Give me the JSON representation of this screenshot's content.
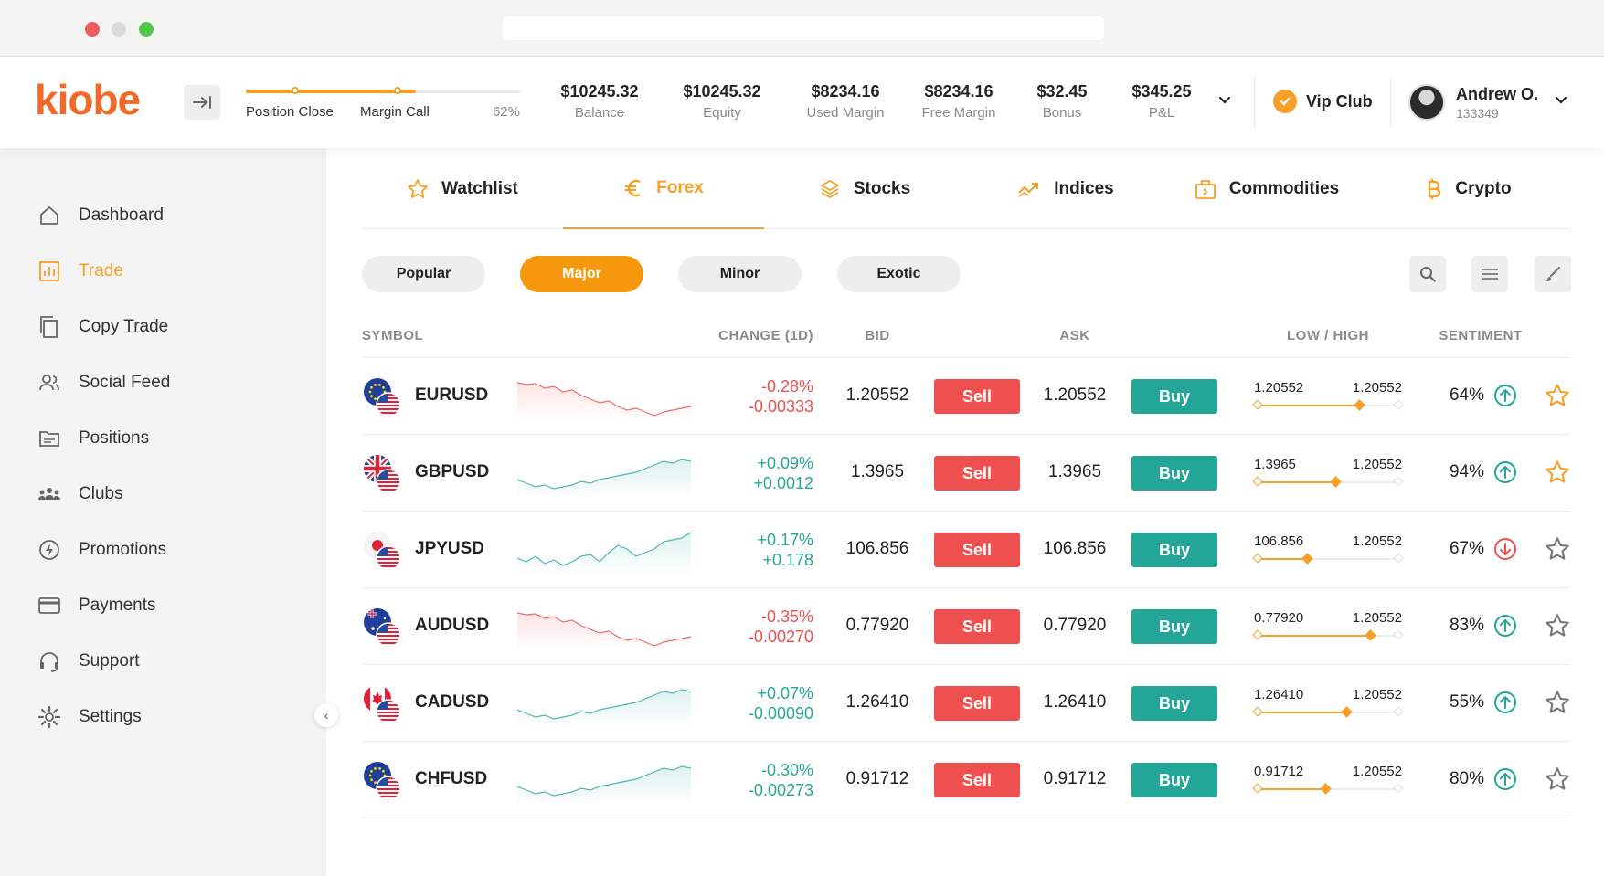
{
  "brand": {
    "logo": "kiobe",
    "accent": "#f6a02a",
    "sell_color": "#ef4f4f",
    "buy_color": "#23a698"
  },
  "margin_meter": {
    "label_left": "Position Close",
    "label_mid": "Margin Call",
    "percent_label": "62%",
    "fill_percent": 62
  },
  "stats": [
    {
      "value": "$10245.32",
      "label": "Balance"
    },
    {
      "value": "$10245.32",
      "label": "Equity"
    },
    {
      "value": "$8234.16",
      "label": "Used Margin"
    },
    {
      "value": "$8234.16",
      "label": "Free Margin"
    },
    {
      "value": "$32.45",
      "label": "Bonus"
    },
    {
      "value": "$345.25",
      "label": "P&L"
    }
  ],
  "vip": {
    "label": "Vip Club"
  },
  "user": {
    "name": "Andrew O.",
    "id": "133349"
  },
  "sidebar": {
    "items": [
      {
        "label": "Dashboard",
        "icon": "home-icon",
        "active": false
      },
      {
        "label": "Trade",
        "icon": "chart-icon",
        "active": true
      },
      {
        "label": "Copy Trade",
        "icon": "copy-icon",
        "active": false
      },
      {
        "label": "Social Feed",
        "icon": "users-icon",
        "active": false
      },
      {
        "label": "Positions",
        "icon": "folder-icon",
        "active": false
      },
      {
        "label": "Clubs",
        "icon": "group-icon",
        "active": false
      },
      {
        "label": "Promotions",
        "icon": "lightning-icon",
        "active": false
      },
      {
        "label": "Payments",
        "icon": "card-icon",
        "active": false
      },
      {
        "label": "Support",
        "icon": "headset-icon",
        "active": false
      },
      {
        "label": "Settings",
        "icon": "gear-icon",
        "active": false
      }
    ]
  },
  "tabs": [
    {
      "label": "Watchlist",
      "icon": "star-icon",
      "active": false
    },
    {
      "label": "Forex",
      "icon": "euro-icon",
      "active": true
    },
    {
      "label": "Stocks",
      "icon": "layers-icon",
      "active": false
    },
    {
      "label": "Indices",
      "icon": "trend-icon",
      "active": false
    },
    {
      "label": "Commodities",
      "icon": "briefcase-icon",
      "active": false
    },
    {
      "label": "Crypto",
      "icon": "bitcoin-icon",
      "active": false
    }
  ],
  "filters": [
    {
      "label": "Popular",
      "active": false
    },
    {
      "label": "Major",
      "active": true
    },
    {
      "label": "Minor",
      "active": false
    },
    {
      "label": "Exotic",
      "active": false
    }
  ],
  "columns": {
    "symbol": "SYMBOL",
    "change": "CHANGE (1D)",
    "bid": "BID",
    "ask": "ASK",
    "lowhigh": "LOW / HIGH",
    "sentiment": "SENTIMENT"
  },
  "buttons": {
    "sell": "Sell",
    "buy": "Buy"
  },
  "rows": [
    {
      "symbol": "EURUSD",
      "flag": "eu",
      "trend": "down",
      "change_pct": "-0.28%",
      "change_abs": "-0.00333",
      "dir": "neg",
      "bid": "1.20552",
      "ask": "1.20552",
      "low": "1.20552",
      "high": "1.20552",
      "range_pos": 0.72,
      "sentiment": "64%",
      "sent_dir": "up",
      "fav": true,
      "spark": [
        8,
        10,
        9,
        14,
        12,
        18,
        16,
        22,
        26,
        30,
        28,
        34,
        38,
        36,
        40,
        44,
        40,
        38,
        36,
        34
      ]
    },
    {
      "symbol": "GBPUSD",
      "flag": "gb",
      "trend": "up",
      "change_pct": "+0.09%",
      "change_abs": "+0.0012",
      "dir": "pos",
      "bid": "1.3965",
      "ask": "1.3965",
      "low": "1.3965",
      "high": "1.20552",
      "range_pos": 0.55,
      "sentiment": "94%",
      "sent_dir": "up",
      "fav": true,
      "spark": [
        30,
        34,
        38,
        36,
        40,
        38,
        36,
        32,
        34,
        30,
        28,
        26,
        24,
        22,
        18,
        14,
        10,
        12,
        8,
        10
      ]
    },
    {
      "symbol": "JPYUSD",
      "flag": "jp",
      "trend": "up",
      "change_pct": "+0.17%",
      "change_abs": "+0.178",
      "dir": "pos",
      "bid": "106.856",
      "ask": "106.856",
      "low": "106.856",
      "high": "1.20552",
      "range_pos": 0.35,
      "sentiment": "67%",
      "sent_dir": "down",
      "fav": false,
      "spark": [
        32,
        36,
        30,
        38,
        34,
        40,
        36,
        30,
        28,
        36,
        26,
        18,
        22,
        30,
        26,
        22,
        14,
        12,
        10,
        4
      ]
    },
    {
      "symbol": "AUDUSD",
      "flag": "au",
      "trend": "down",
      "change_pct": "-0.35%",
      "change_abs": "-0.00270",
      "dir": "neg",
      "bid": "0.77920",
      "ask": "0.77920",
      "low": "0.77920",
      "high": "1.20552",
      "range_pos": 0.8,
      "sentiment": "83%",
      "sent_dir": "up",
      "fav": false,
      "spark": [
        8,
        10,
        9,
        14,
        12,
        18,
        16,
        22,
        26,
        30,
        28,
        34,
        38,
        36,
        40,
        44,
        40,
        38,
        36,
        34
      ]
    },
    {
      "symbol": "CADUSD",
      "flag": "ca",
      "trend": "up",
      "change_pct": "+0.07%",
      "change_abs": "-0.00090",
      "dir": "pos",
      "bid": "1.26410",
      "ask": "1.26410",
      "low": "1.26410",
      "high": "1.20552",
      "range_pos": 0.63,
      "sentiment": "55%",
      "sent_dir": "up",
      "fav": false,
      "spark": [
        30,
        34,
        38,
        36,
        40,
        38,
        36,
        32,
        34,
        30,
        28,
        26,
        24,
        22,
        18,
        14,
        10,
        12,
        8,
        10
      ]
    },
    {
      "symbol": "CHFUSD",
      "flag": "eu",
      "trend": "up",
      "change_pct": "-0.30%",
      "change_abs": "-0.00273",
      "dir": "pos",
      "bid": "0.91712",
      "ask": "0.91712",
      "low": "0.91712",
      "high": "1.20552",
      "range_pos": 0.48,
      "sentiment": "80%",
      "sent_dir": "up",
      "fav": false,
      "spark": [
        30,
        34,
        38,
        36,
        40,
        38,
        36,
        32,
        34,
        30,
        28,
        26,
        24,
        22,
        18,
        14,
        10,
        12,
        8,
        10
      ]
    }
  ]
}
